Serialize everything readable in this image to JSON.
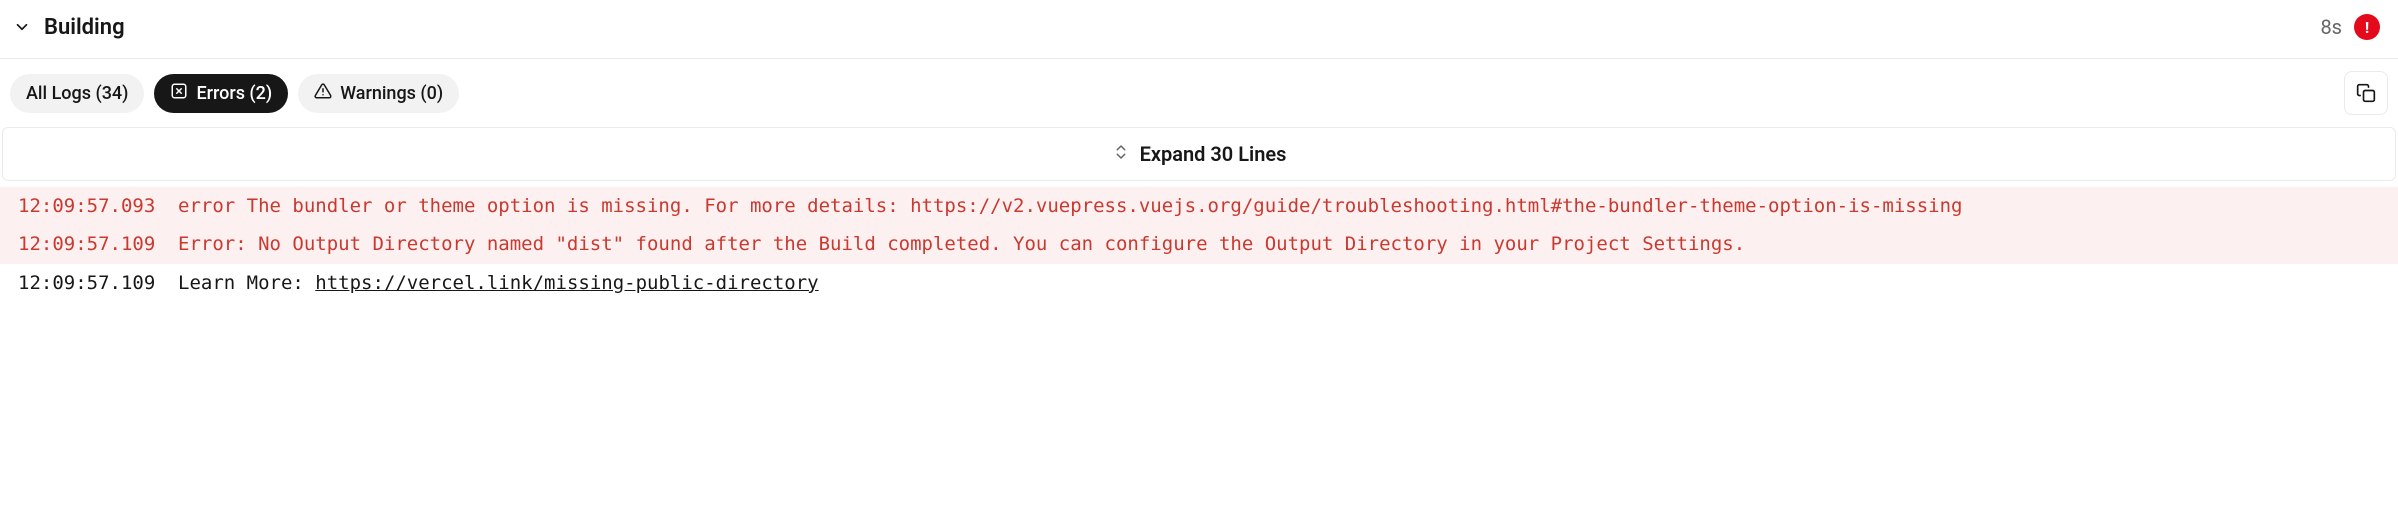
{
  "header": {
    "title": "Building",
    "duration": "8s",
    "status": "error"
  },
  "tabs": {
    "all": {
      "label": "All Logs (34)"
    },
    "errors": {
      "label": "Errors (2)"
    },
    "warnings": {
      "label": "Warnings (0)"
    }
  },
  "expand": {
    "label": "Expand 30 Lines"
  },
  "logs": [
    {
      "ts": "12:09:57.093",
      "level": "error",
      "msg": "error The bundler or theme option is missing. For more details: https://v2.vuepress.vuejs.org/guide/troubleshooting.html#the-bundler-theme-option-is-missing"
    },
    {
      "ts": "12:09:57.109",
      "level": "error",
      "msg": "Error: No Output Directory named \"dist\" found after the Build completed. You can configure the Output Directory in your Project Settings."
    },
    {
      "ts": "12:09:57.109",
      "level": "info",
      "prefix": "Learn More: ",
      "link": "https://vercel.link/missing-public-directory"
    }
  ]
}
